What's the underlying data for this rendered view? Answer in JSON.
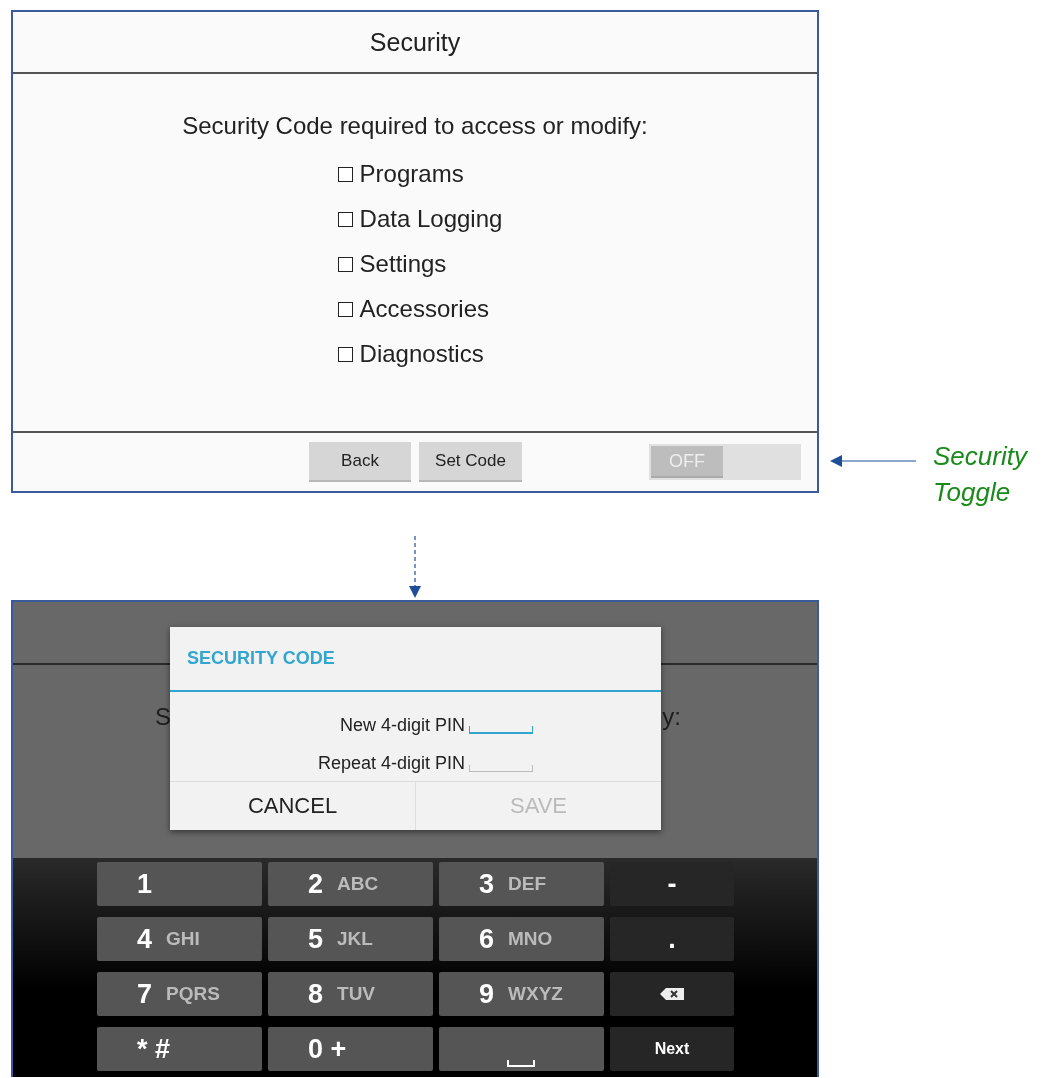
{
  "settings_screen": {
    "title": "Security",
    "prompt": "Security Code required to access or modify:",
    "options": [
      {
        "label": "Programs",
        "checked": false
      },
      {
        "label": "Data Logging",
        "checked": false
      },
      {
        "label": "Settings",
        "checked": false
      },
      {
        "label": "Accessories",
        "checked": false
      },
      {
        "label": "Diagnostics",
        "checked": false
      }
    ],
    "buttons": [
      "Back",
      "Set Code"
    ],
    "toggle": {
      "label": "OFF",
      "on": false
    }
  },
  "callout": {
    "label": "Security Toggle"
  },
  "dialog_screen": {
    "background_fragments": [
      "S",
      "y:"
    ],
    "dialog": {
      "title": "SECURITY CODE",
      "fields": [
        {
          "label": "New 4-digit PIN",
          "focused": true
        },
        {
          "label": "Repeat 4-digit PIN",
          "focused": false
        }
      ],
      "buttons": [
        {
          "label": "CANCEL",
          "disabled": false
        },
        {
          "label": "SAVE",
          "disabled": true
        }
      ]
    },
    "keypad": [
      {
        "kind": "digit",
        "main": "1"
      },
      {
        "kind": "digit",
        "main": "2",
        "sub": "ABC"
      },
      {
        "kind": "digit",
        "main": "3",
        "sub": "DEF"
      },
      {
        "kind": "function",
        "main": "-"
      },
      {
        "kind": "digit",
        "main": "4",
        "sub": "GHI"
      },
      {
        "kind": "digit",
        "main": "5",
        "sub": "JKL"
      },
      {
        "kind": "digit",
        "main": "6",
        "sub": "MNO"
      },
      {
        "kind": "function",
        "main": "."
      },
      {
        "kind": "digit",
        "main": "7",
        "sub": "PQRS"
      },
      {
        "kind": "digit",
        "main": "8",
        "sub": "TUV"
      },
      {
        "kind": "digit",
        "main": "9",
        "sub": "WXYZ"
      },
      {
        "kind": "backspace"
      },
      {
        "kind": "digit",
        "main": "* #"
      },
      {
        "kind": "digit",
        "main": "0 +"
      },
      {
        "kind": "space"
      },
      {
        "kind": "action",
        "main": "Next"
      }
    ]
  }
}
